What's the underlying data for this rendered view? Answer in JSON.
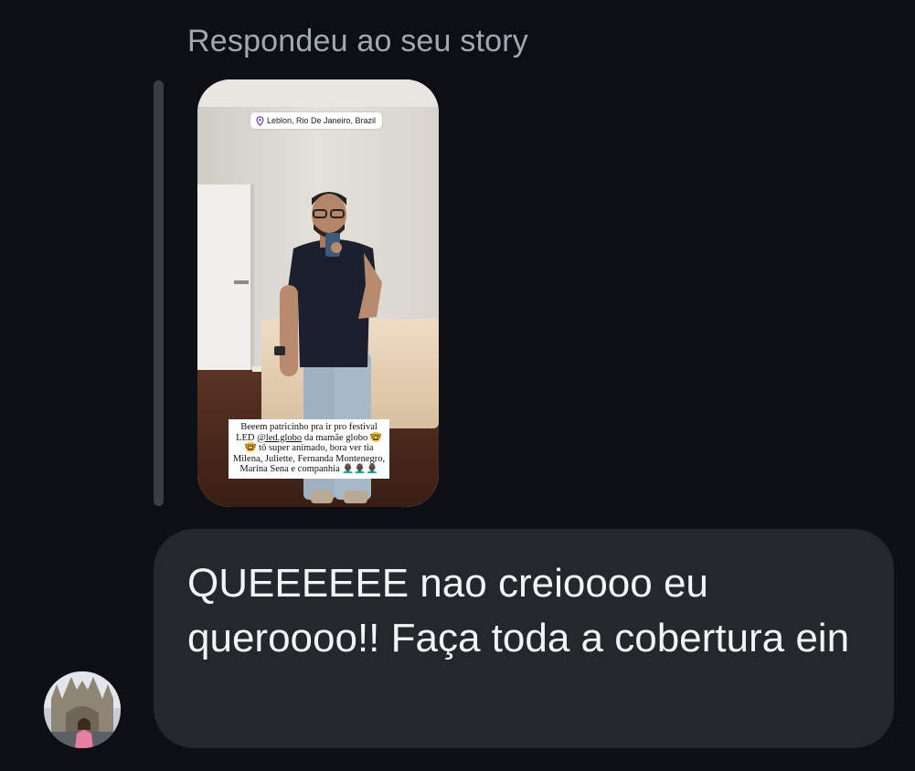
{
  "reply_header": "Respondeu ao seu story",
  "story": {
    "location": "Leblon, Rio De Janeiro, Brazil",
    "location_icon": "location-pin-icon",
    "caption_prefix": "Beeem patricinho pra ir pro festival LED",
    "caption_mention": "@led.globo",
    "caption_rest": "da mamãe globo 🤓🤓 tô super animado, bora ver tia Milena, Juliette, Fernanda Montenegro, Marina Sena e companhia 👨🏿‍🦲👨🏿‍🦲👨🏿‍🦲"
  },
  "message": {
    "text": "QUEEEEEE nao creioooo eu queroooo!! Faça toda a cobertura ein"
  },
  "avatar": {
    "icon": "profile-photo"
  },
  "colors": {
    "background": "#0c0f14",
    "bubble": "#25272d",
    "reply_bar": "#3a3d44",
    "header_text": "#a3a8b0",
    "message_text": "#f3f4f6",
    "location_pin": "#7b3fb8"
  }
}
